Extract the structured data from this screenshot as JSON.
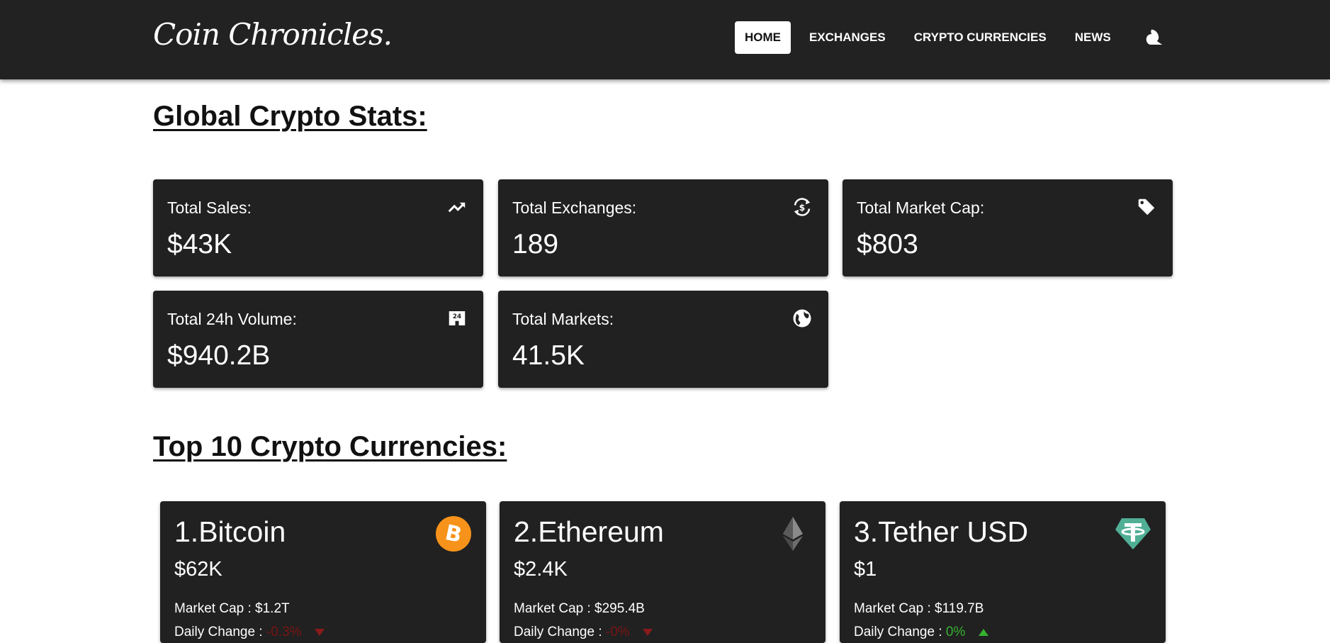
{
  "navbar": {
    "logo": "Coin Chronicles.",
    "links": [
      "HOME",
      "EXCHANGES",
      "CRYPTO CURRENCIES",
      "NEWS"
    ],
    "active": "HOME",
    "theme_icon": "moon-icon"
  },
  "global_stats": {
    "title": "Global Crypto Stats:",
    "cards": [
      {
        "label": "Total Sales:",
        "value": "$43K",
        "icon": "trending-up-icon"
      },
      {
        "label": "Total Exchanges:",
        "value": "189",
        "icon": "currency-exchange-icon"
      },
      {
        "label": "Total Market Cap:",
        "value": "$803",
        "icon": "tag-icon"
      },
      {
        "label": "Total 24h Volume:",
        "value": "$940.2B",
        "icon": "24h-store-icon"
      },
      {
        "label": "Total Markets:",
        "value": "41.5K",
        "icon": "globe-icon"
      }
    ]
  },
  "top_coins": {
    "title": "Top 10 Crypto Currencies:",
    "coins": [
      {
        "name": "1.Bitcoin",
        "price": "$62K",
        "market_cap_label": "Market Cap :",
        "market_cap": "$1.2T",
        "change_label": "Daily Change :",
        "change": "-0.3%",
        "direction": "down",
        "logo": "bitcoin-logo-icon"
      },
      {
        "name": "2.Ethereum",
        "price": "$2.4K",
        "market_cap_label": "Market Cap :",
        "market_cap": "$295.4B",
        "change_label": "Daily Change :",
        "change": "-0%",
        "direction": "down",
        "logo": "ethereum-logo-icon"
      },
      {
        "name": "3.Tether USD",
        "price": "$1",
        "market_cap_label": "Market Cap :",
        "market_cap": "$119.7B",
        "change_label": "Daily Change :",
        "change": "0%",
        "direction": "up",
        "logo": "tether-logo-icon"
      }
    ]
  },
  "colors": {
    "navbar_bg": "#222222",
    "card_bg": "#212121",
    "negative": "#7a1414",
    "positive": "#35b02f",
    "bitcoin": "#f7931a",
    "tether": "#50af95"
  }
}
